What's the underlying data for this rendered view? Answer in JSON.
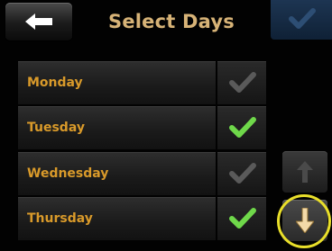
{
  "header": {
    "title": "Select Days",
    "back_icon": "back-arrow-icon",
    "confirm_icon": "checkmark-icon"
  },
  "days": [
    {
      "label": "Monday",
      "checked": false
    },
    {
      "label": "Tuesday",
      "checked": true
    },
    {
      "label": "Wednesday",
      "checked": false
    },
    {
      "label": "Thursday",
      "checked": true
    }
  ],
  "scroll": {
    "up_icon": "arrow-up-icon",
    "down_icon": "arrow-down-icon"
  },
  "colors": {
    "label": "#d99a2a",
    "title": "#d7b377",
    "check_on": "#6fd84a",
    "check_off": "#5a5a5a",
    "confirm_bg": "#1d3552",
    "highlight": "#e9df2a"
  }
}
